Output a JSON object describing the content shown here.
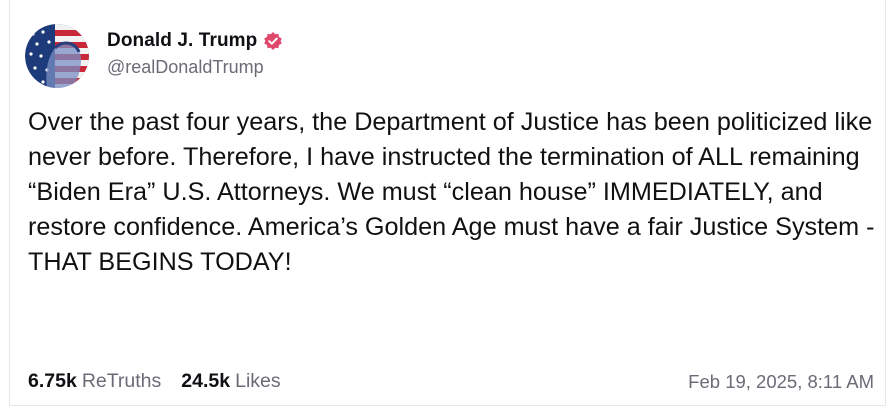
{
  "author": {
    "display_name": "Donald J. Trump",
    "handle": "@realDonaldTrump",
    "avatar_icon": "profile-avatar",
    "verified_icon": "verified-badge-icon",
    "verified_color": "#e0486b"
  },
  "post": {
    "text": "Over the past four years, the Department of Justice has been politicized like never before. Therefore, I have instructed the termination of ALL remaining “Biden Era” U.S. Attorneys. We must “clean house” IMMEDIATELY, and restore confidence. America’s Golden Age must have a fair Justice System - THAT BEGINS TODAY!"
  },
  "stats": {
    "retruths_count": "6.75k",
    "retruths_label": "ReTruths",
    "likes_count": "24.5k",
    "likes_label": "Likes"
  },
  "timestamp": "Feb 19, 2025, 8:11 AM"
}
